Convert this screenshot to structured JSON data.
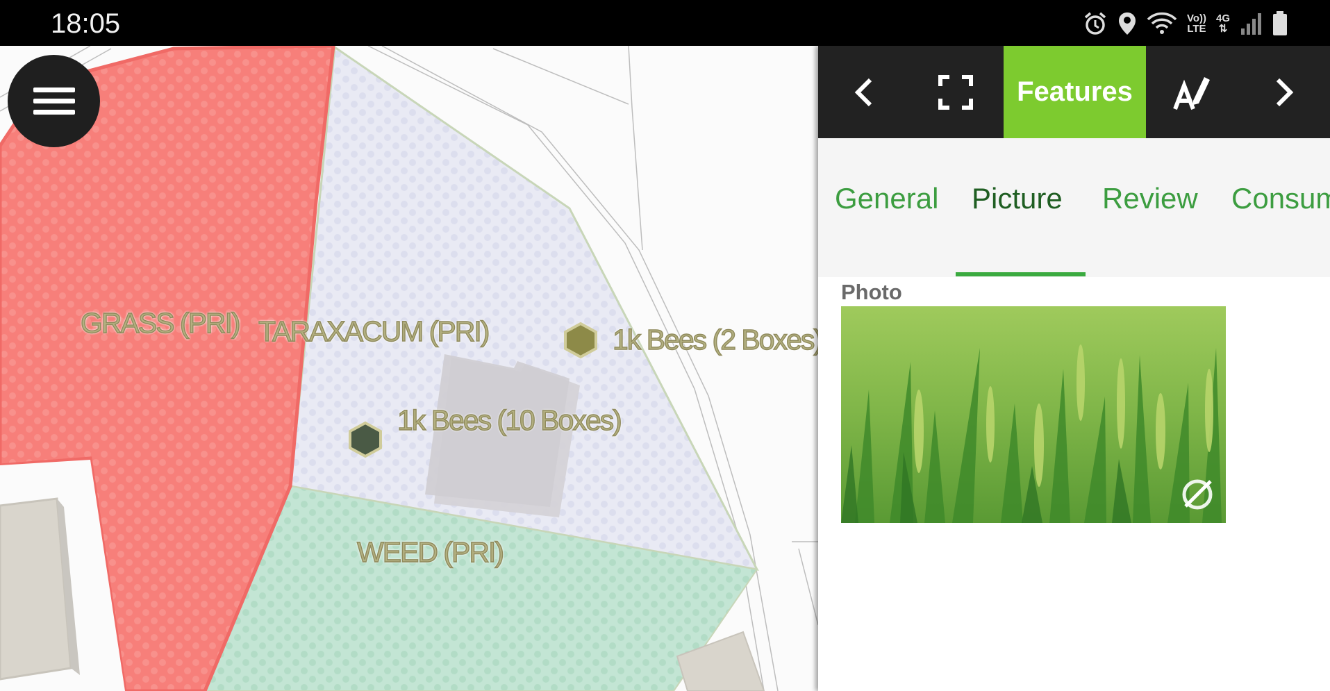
{
  "status_bar": {
    "time": "18:05",
    "icons": [
      "alarm-icon",
      "location-icon",
      "wifi-icon",
      "volte-icon",
      "4g-icon",
      "signal-icon",
      "battery-icon"
    ],
    "volte_line1": "Vo))",
    "volte_line2": "LTE",
    "network": "4G"
  },
  "map": {
    "labels": {
      "grass": "GRASS (PRI)",
      "taraxacum": "TARAXACUM (PRI)",
      "weed": "WEED (PRI)",
      "bees_2": "1k Bees (2 Boxes)",
      "bees_10": "1k Bees (10 Boxes)"
    },
    "colors": {
      "grass_fill": "#f77f7a",
      "taraxacum_fill": "#e8e9f4",
      "weed_fill": "#bfe3d1",
      "label": "#b3b081"
    }
  },
  "toolbar": {
    "active_label": "Features",
    "accent": "#7dcb2f",
    "icons": [
      "chevron-left-icon",
      "fullscreen-icon",
      "edit-text-icon",
      "chevron-right-icon"
    ]
  },
  "tabs": [
    {
      "label": "General"
    },
    {
      "label": "Picture"
    },
    {
      "label": "Review"
    },
    {
      "label": "Consumption"
    }
  ],
  "active_tab": "Picture",
  "content": {
    "photo_label": "Photo"
  }
}
